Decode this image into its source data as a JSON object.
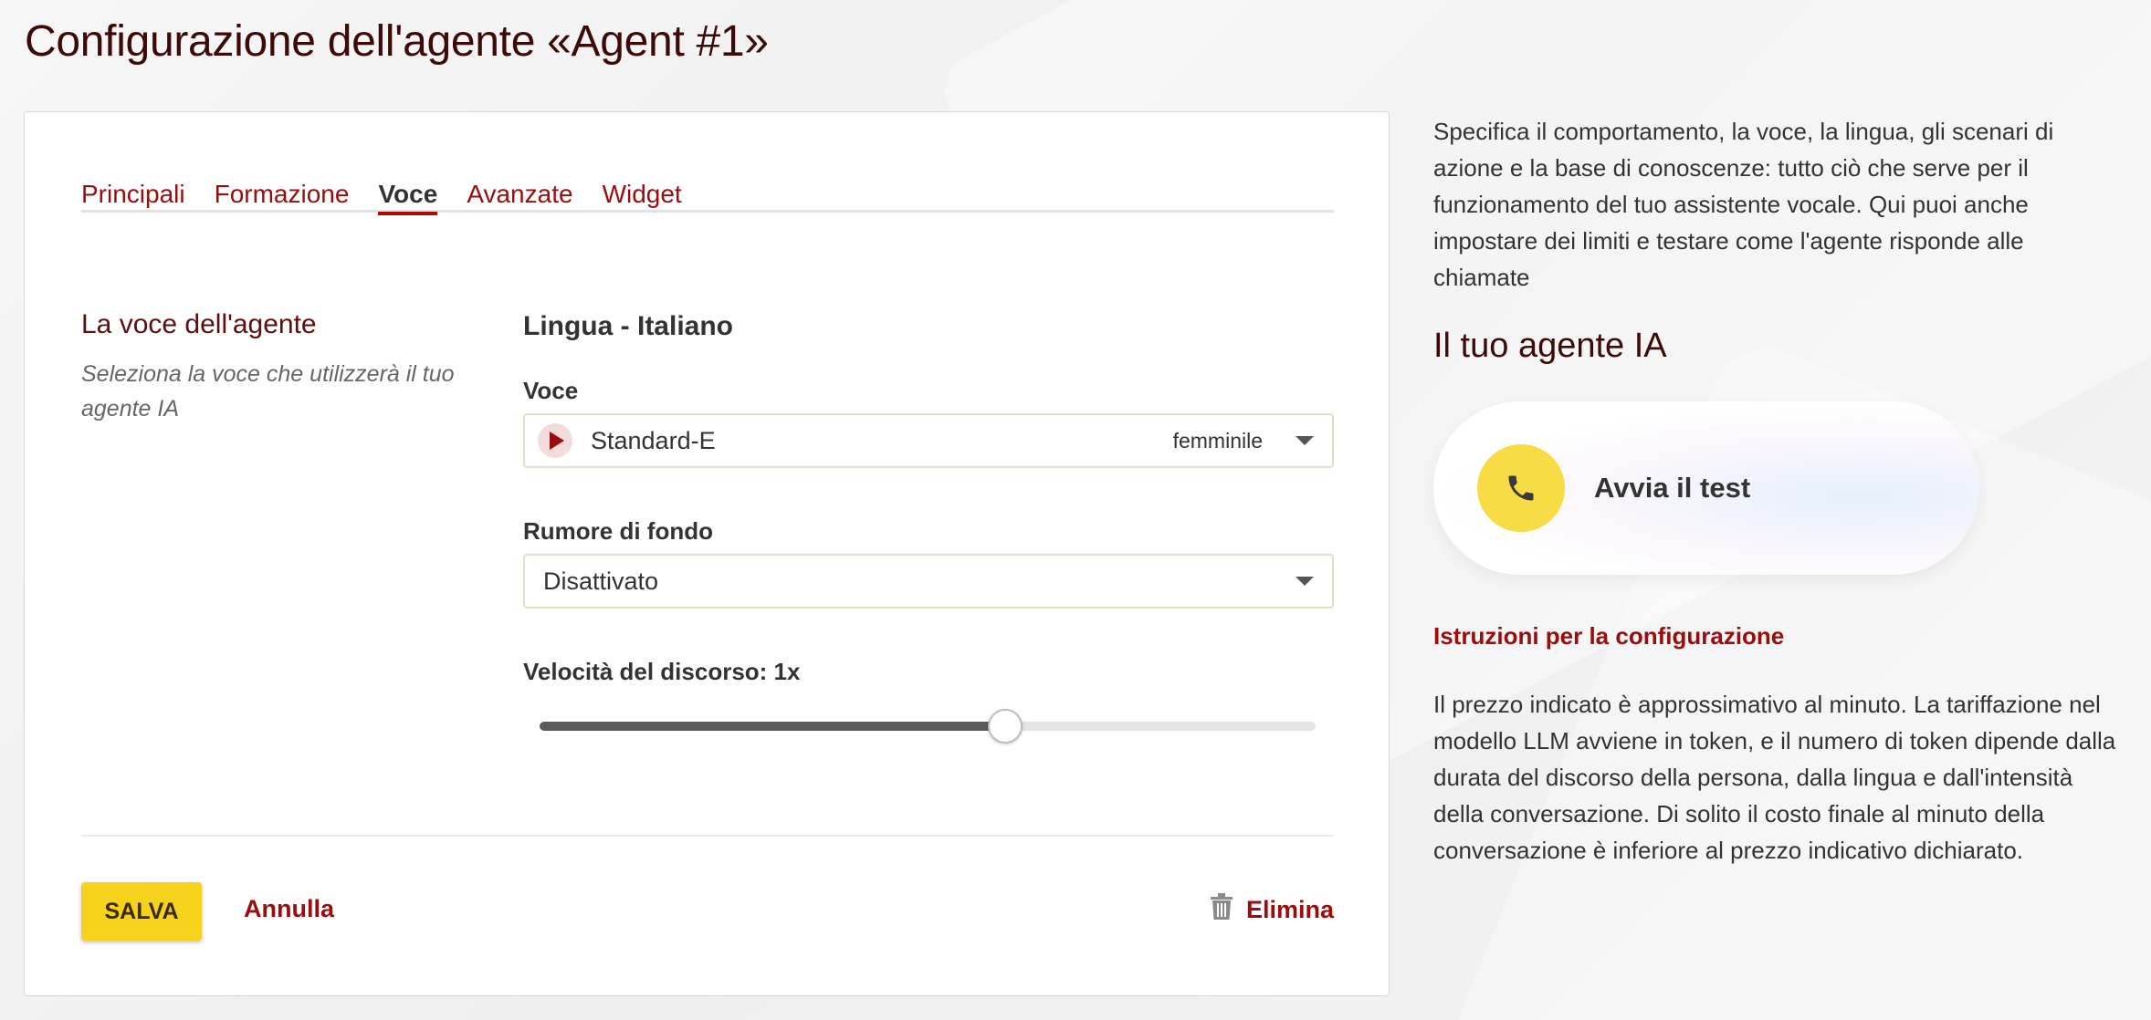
{
  "header": {
    "title": "Configurazione dell'agente «Agent #1»"
  },
  "tabs": [
    {
      "label": "Principali"
    },
    {
      "label": "Formazione"
    },
    {
      "label": "Voce",
      "active": true
    },
    {
      "label": "Avanzate"
    },
    {
      "label": "Widget"
    }
  ],
  "voice_section": {
    "title": "La voce dell'agente",
    "description": "Seleziona la voce che utilizzerà il tuo agente IA",
    "language_title": "Lingua - Italiano",
    "voice_label": "Voce",
    "voice_value": "Standard-E",
    "voice_gender": "femminile",
    "noise_label": "Rumore di fondo",
    "noise_value": "Disattivato",
    "speed_label": "Velocità del discorso: 1x",
    "speed_fraction": 0.6
  },
  "actions": {
    "save_label": "SALVA",
    "cancel_label": "Annulla",
    "delete_label": "Elimina"
  },
  "sidebar": {
    "description": "Specifica il comportamento, la voce, la lingua, gli scenari di azione e la base di conoscenze: tutto ciò che serve per il funzionamento del tuo assistente vocale. Qui puoi anche impostare dei limiti e testare come l'agente risponde alle chiamate",
    "agent_title": "Il tuo agente IA",
    "test_label": "Avvia il test",
    "instructions_link": "Istruzioni per la configurazione",
    "price_note": "Il prezzo indicato è approssimativo al minuto. La tariffazione nel modello LLM avviene in token, e il numero di token dipende dalla durata del discorso della persona, dalla lingua e dall'intensità della conversazione. Di solito il costo finale al minuto della conversazione è inferiore al prezzo indicativo dichiarato."
  },
  "colors": {
    "accent": "#9b0d0d",
    "title": "#3d0a0a",
    "button_yellow": "#f7d21c",
    "phone_yellow": "#f8dc45"
  },
  "icons": {
    "play": "play-icon",
    "caret": "chevron-down-icon",
    "trash": "trash-icon",
    "phone": "phone-icon"
  }
}
